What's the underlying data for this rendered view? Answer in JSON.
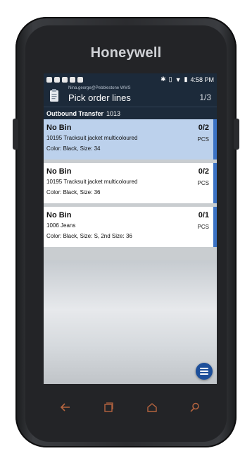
{
  "device": {
    "brand": "Honeywell"
  },
  "status_bar": {
    "time": "4:58 PM"
  },
  "app_bar": {
    "user": "Nina.george@Pebblestone WMS",
    "title": "Pick order lines",
    "page_count": "1/3"
  },
  "sub_header": {
    "label": "Outbound Transfer",
    "number": "1013"
  },
  "order_lines": [
    {
      "bin": "No Bin",
      "qty": "0/2",
      "product": "10195 Tracksuit jacket multicoloured",
      "unit": "PCS",
      "attributes": "Color: Black, Size: 34",
      "selected": true
    },
    {
      "bin": "No Bin",
      "qty": "0/2",
      "product": "10195 Tracksuit jacket multicoloured",
      "unit": "PCS",
      "attributes": "Color: Black, Size: 36",
      "selected": false
    },
    {
      "bin": "No Bin",
      "qty": "0/1",
      "product": "1006 Jeans",
      "unit": "PCS",
      "attributes": "Color: Black, Size: S, 2nd Size: 36",
      "selected": false
    }
  ],
  "fab": {
    "icon": "menu-icon"
  },
  "nav_bar": {
    "icons": [
      "back-icon",
      "recent-apps-icon",
      "home-icon",
      "search-icon"
    ]
  },
  "colors": {
    "header": "#1c2a3a",
    "accent": "#3b72c4",
    "selected_row": "#bcd1ec"
  }
}
